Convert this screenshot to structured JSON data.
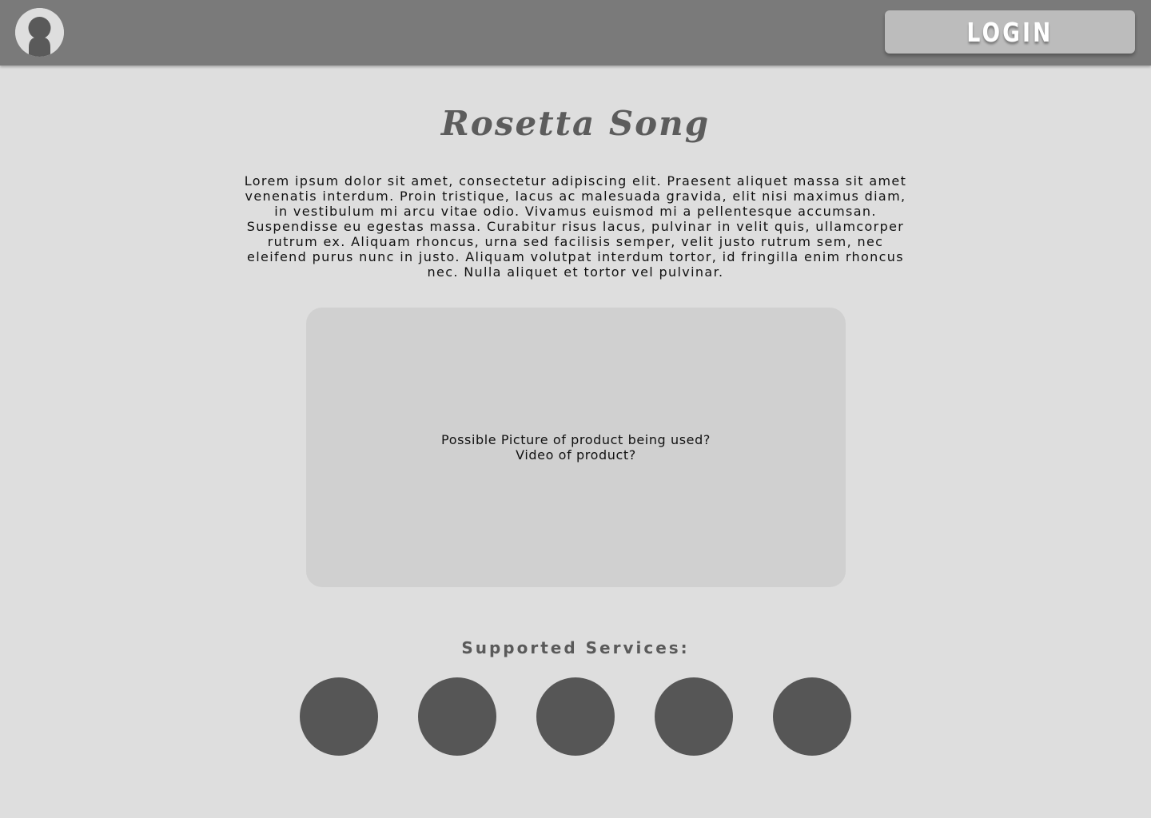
{
  "header": {
    "avatar_icon": "user-avatar-icon",
    "login_label": "LOGIN"
  },
  "main": {
    "title": "Rosetta Song",
    "intro": "Lorem ipsum dolor sit amet, consectetur adipiscing elit. Praesent aliquet massa sit amet venenatis interdum. Proin tristique, lacus ac malesuada gravida, elit nisi maximus diam, in vestibulum mi arcu vitae odio. Vivamus euismod mi a pellentesque accumsan. Suspendisse eu egestas massa. Curabitur risus lacus, pulvinar in velit quis, ullamcorper rutrum ex. Aliquam rhoncus, urna sed facilisis semper, velit justo rutrum sem, nec eleifend purus nunc in justo. Aliquam volutpat interdum tortor, id fringilla enim rhoncus nec. Nulla aliquet et tortor vel pulvinar.",
    "media_placeholder": {
      "line1": "Possible Picture of product being used?",
      "line2": "Video of product?"
    }
  },
  "services": {
    "title": "Supported Services:",
    "count": 5
  },
  "colors": {
    "topbar": "#7a7a7a",
    "background": "#dedede",
    "button": "#bcbcbc",
    "placeholder": "#d0d0d0",
    "service_circle": "#565656",
    "title_text": "#5c5c5c"
  }
}
